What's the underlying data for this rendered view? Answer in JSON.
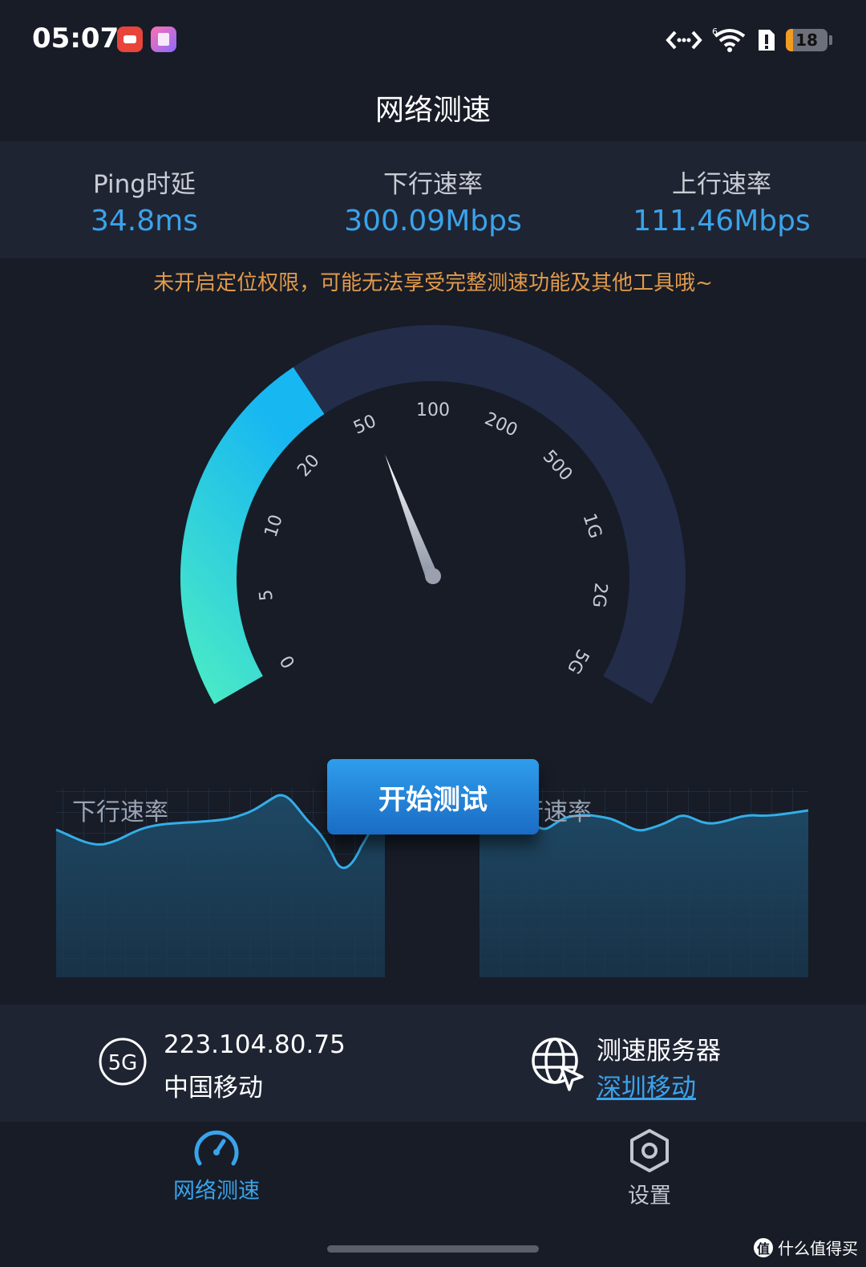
{
  "status_bar": {
    "time": "05:07",
    "battery": "18"
  },
  "header": {
    "title": "网络测速"
  },
  "stats": [
    {
      "label": "Ping时延",
      "value": "34.8ms"
    },
    {
      "label": "下行速率",
      "value": "300.09Mbps"
    },
    {
      "label": "上行速率",
      "value": "111.46Mbps"
    }
  ],
  "warning": "未开启定位权限，可能无法享受完整测速功能及其他工具哦~",
  "gauge": {
    "tick_labels": [
      "0",
      "5",
      "10",
      "20",
      "50",
      "100",
      "200",
      "500",
      "1G",
      "2G",
      "5G"
    ],
    "progress_fraction": 0.36
  },
  "start_button": "开始测试",
  "charts": {
    "download_label": "下行速率",
    "upload_label": "上行速率"
  },
  "network": {
    "type_icon": "5G",
    "ip": "223.104.80.75",
    "carrier": "中国移动"
  },
  "server": {
    "label": "测速服务器",
    "name": "深圳移动"
  },
  "tabs": [
    {
      "label": "网络测速",
      "active": true
    },
    {
      "label": "设置",
      "active": false
    }
  ],
  "watermark": {
    "text": "什么值得买",
    "symbol": "值"
  },
  "colors": {
    "accent": "#3aa3ea",
    "warning": "#e29a4a",
    "gauge_start": "#48e8c8",
    "gauge_end": "#17b7f2",
    "gauge_track": "#232d4a"
  }
}
